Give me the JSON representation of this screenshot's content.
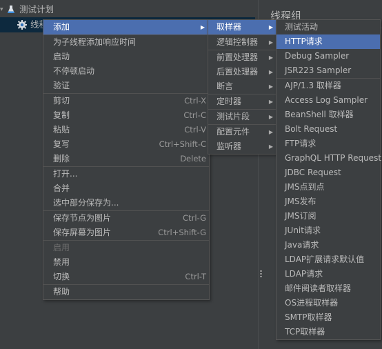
{
  "tree": {
    "items": [
      {
        "label": "测试计划",
        "icon": "flask-icon",
        "expanded": true
      },
      {
        "label": "线程组",
        "icon": "gear-icon",
        "selected": true
      }
    ]
  },
  "right_panel": {
    "title": "线程组"
  },
  "context_menu": {
    "items": [
      {
        "label": "添加",
        "submenu": true,
        "active": true
      },
      {
        "label": "为子线程添加响应时间"
      },
      {
        "label": "启动"
      },
      {
        "label": "不停顿启动"
      },
      {
        "label": "验证"
      },
      {
        "label": "剪切",
        "shortcut": "Ctrl-X"
      },
      {
        "label": "复制",
        "shortcut": "Ctrl-C"
      },
      {
        "label": "粘贴",
        "shortcut": "Ctrl-V"
      },
      {
        "label": "复写",
        "shortcut": "Ctrl+Shift-C"
      },
      {
        "label": "删除",
        "shortcut": "Delete"
      },
      {
        "label": "打开..."
      },
      {
        "label": "合并"
      },
      {
        "label": "选中部分保存为..."
      },
      {
        "label": "保存节点为图片",
        "shortcut": "Ctrl-G"
      },
      {
        "label": "保存屏幕为图片",
        "shortcut": "Ctrl+Shift-G"
      },
      {
        "label": "启用",
        "disabled": true
      },
      {
        "label": "禁用"
      },
      {
        "label": "切换",
        "shortcut": "Ctrl-T"
      },
      {
        "label": "帮助"
      }
    ]
  },
  "add_submenu": {
    "items": [
      {
        "label": "取样器",
        "active": true
      },
      {
        "label": "逻辑控制器"
      },
      {
        "label": "前置处理器"
      },
      {
        "label": "后置处理器"
      },
      {
        "label": "断言"
      },
      {
        "label": "定时器"
      },
      {
        "label": "测试片段"
      },
      {
        "label": "配置元件"
      },
      {
        "label": "监听器"
      }
    ]
  },
  "sampler_submenu": {
    "items": [
      {
        "label": "测试活动"
      },
      {
        "label": "HTTP请求",
        "active": true
      },
      {
        "label": "Debug Sampler"
      },
      {
        "label": "JSR223 Sampler"
      },
      {
        "label": "AJP/1.3 取样器"
      },
      {
        "label": "Access Log Sampler"
      },
      {
        "label": "BeanShell 取样器"
      },
      {
        "label": "Bolt Request"
      },
      {
        "label": "FTP请求"
      },
      {
        "label": "GraphQL HTTP Request"
      },
      {
        "label": "JDBC Request"
      },
      {
        "label": "JMS点到点"
      },
      {
        "label": "JMS发布"
      },
      {
        "label": "JMS订阅"
      },
      {
        "label": "JUnit请求"
      },
      {
        "label": "Java请求"
      },
      {
        "label": "LDAP扩展请求默认值"
      },
      {
        "label": "LDAP请求"
      },
      {
        "label": "邮件阅读者取样器"
      },
      {
        "label": "OS进程取样器"
      },
      {
        "label": "SMTP取样器"
      },
      {
        "label": "TCP取样器"
      }
    ]
  },
  "colors": {
    "accent": "#4b6eaf",
    "background": "#3c3f41",
    "selection": "#0d293e"
  }
}
